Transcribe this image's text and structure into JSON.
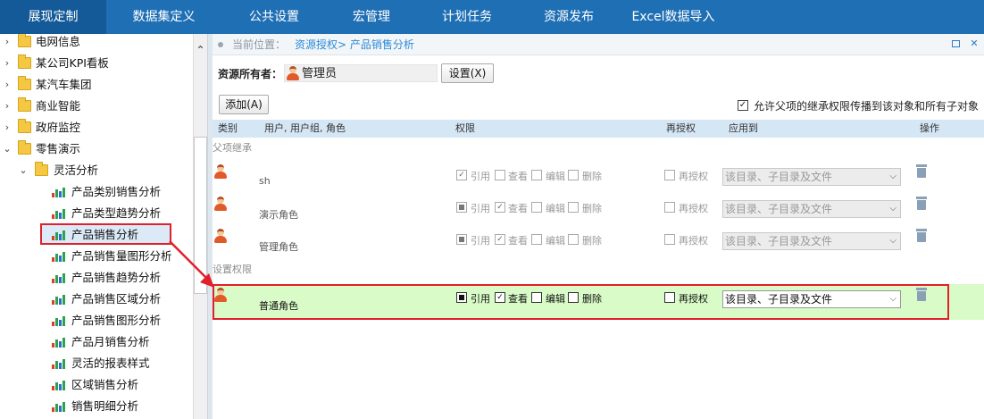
{
  "topnav": {
    "tabs": [
      {
        "label": "展现定制",
        "active": true
      },
      {
        "label": "数据集定义",
        "active": false
      },
      {
        "label": "公共设置",
        "active": false
      },
      {
        "label": "宏管理",
        "active": false
      },
      {
        "label": "计划任务",
        "active": false
      },
      {
        "label": "资源发布",
        "active": false
      },
      {
        "label": "Excel数据导入",
        "active": false
      }
    ]
  },
  "tree": {
    "items": [
      {
        "label": "电网信息",
        "type": "folder",
        "expanded": false
      },
      {
        "label": "某公司KPI看板",
        "type": "folder",
        "expanded": false
      },
      {
        "label": "某汽车集团",
        "type": "folder",
        "expanded": false
      },
      {
        "label": "商业智能",
        "type": "folder",
        "expanded": false
      },
      {
        "label": "政府监控",
        "type": "folder",
        "expanded": false
      },
      {
        "label": "零售演示",
        "type": "folder",
        "expanded": true
      },
      {
        "label": "灵活分析",
        "type": "folder",
        "expanded": true
      },
      {
        "label": "产品类别销售分析",
        "type": "report"
      },
      {
        "label": "产品类型趋势分析",
        "type": "report"
      },
      {
        "label": "产品销售分析",
        "type": "report",
        "selected": true
      },
      {
        "label": "产品销售量图形分析",
        "type": "report"
      },
      {
        "label": "产品销售趋势分析",
        "type": "report"
      },
      {
        "label": "产品销售区域分析",
        "type": "report"
      },
      {
        "label": "产品销售图形分析",
        "type": "report"
      },
      {
        "label": "产品月销售分析",
        "type": "report"
      },
      {
        "label": "灵活的报表样式",
        "type": "report"
      },
      {
        "label": "区域销售分析",
        "type": "report"
      },
      {
        "label": "销售明细分析",
        "type": "report"
      }
    ]
  },
  "breadcrumb": {
    "label": "当前位置：",
    "path": "资源授权> 产品销售分析"
  },
  "owner": {
    "label": "资源所有者：",
    "name": "管理员",
    "set_button": "设置(X)"
  },
  "add_button": "添加(A)",
  "inherit": {
    "checked": true,
    "label": "允许父项的继承权限传播到该对象和所有子对象"
  },
  "table": {
    "headers": {
      "type": "类别",
      "user": "用户, 用户组, 角色",
      "perm": "权限",
      "regrant": "再授权",
      "apply": "应用到",
      "ops": "操作"
    },
    "sections": {
      "inherited": "父项继承",
      "set": "设置权限"
    },
    "perm_labels": [
      "引用",
      "查看",
      "编辑",
      "删除"
    ],
    "regrant_label": "再授权",
    "inherited_rows": [
      {
        "name": "sh",
        "ref": "check",
        "view": "empty",
        "edit": "empty",
        "del": "empty",
        "apply": "该目录、子目录及文件"
      },
      {
        "name": "演示角色",
        "ref": "square",
        "view": "check",
        "edit": "empty",
        "del": "empty",
        "apply": "该目录、子目录及文件"
      },
      {
        "name": "管理角色",
        "ref": "square",
        "view": "check",
        "edit": "empty",
        "del": "empty",
        "apply": "该目录、子目录及文件"
      }
    ],
    "set_rows": [
      {
        "name": "普通角色",
        "ref": "square",
        "view": "check",
        "edit": "empty",
        "del": "empty",
        "apply": "该目录、子目录及文件"
      }
    ]
  },
  "colors": {
    "nav_bg": "#1f6fb5",
    "nav_active": "#145a98",
    "header_row": "#d5e6f5",
    "active_row": "#d9fbc7",
    "highlight": "#e0202a",
    "link": "#2b8ad6"
  }
}
